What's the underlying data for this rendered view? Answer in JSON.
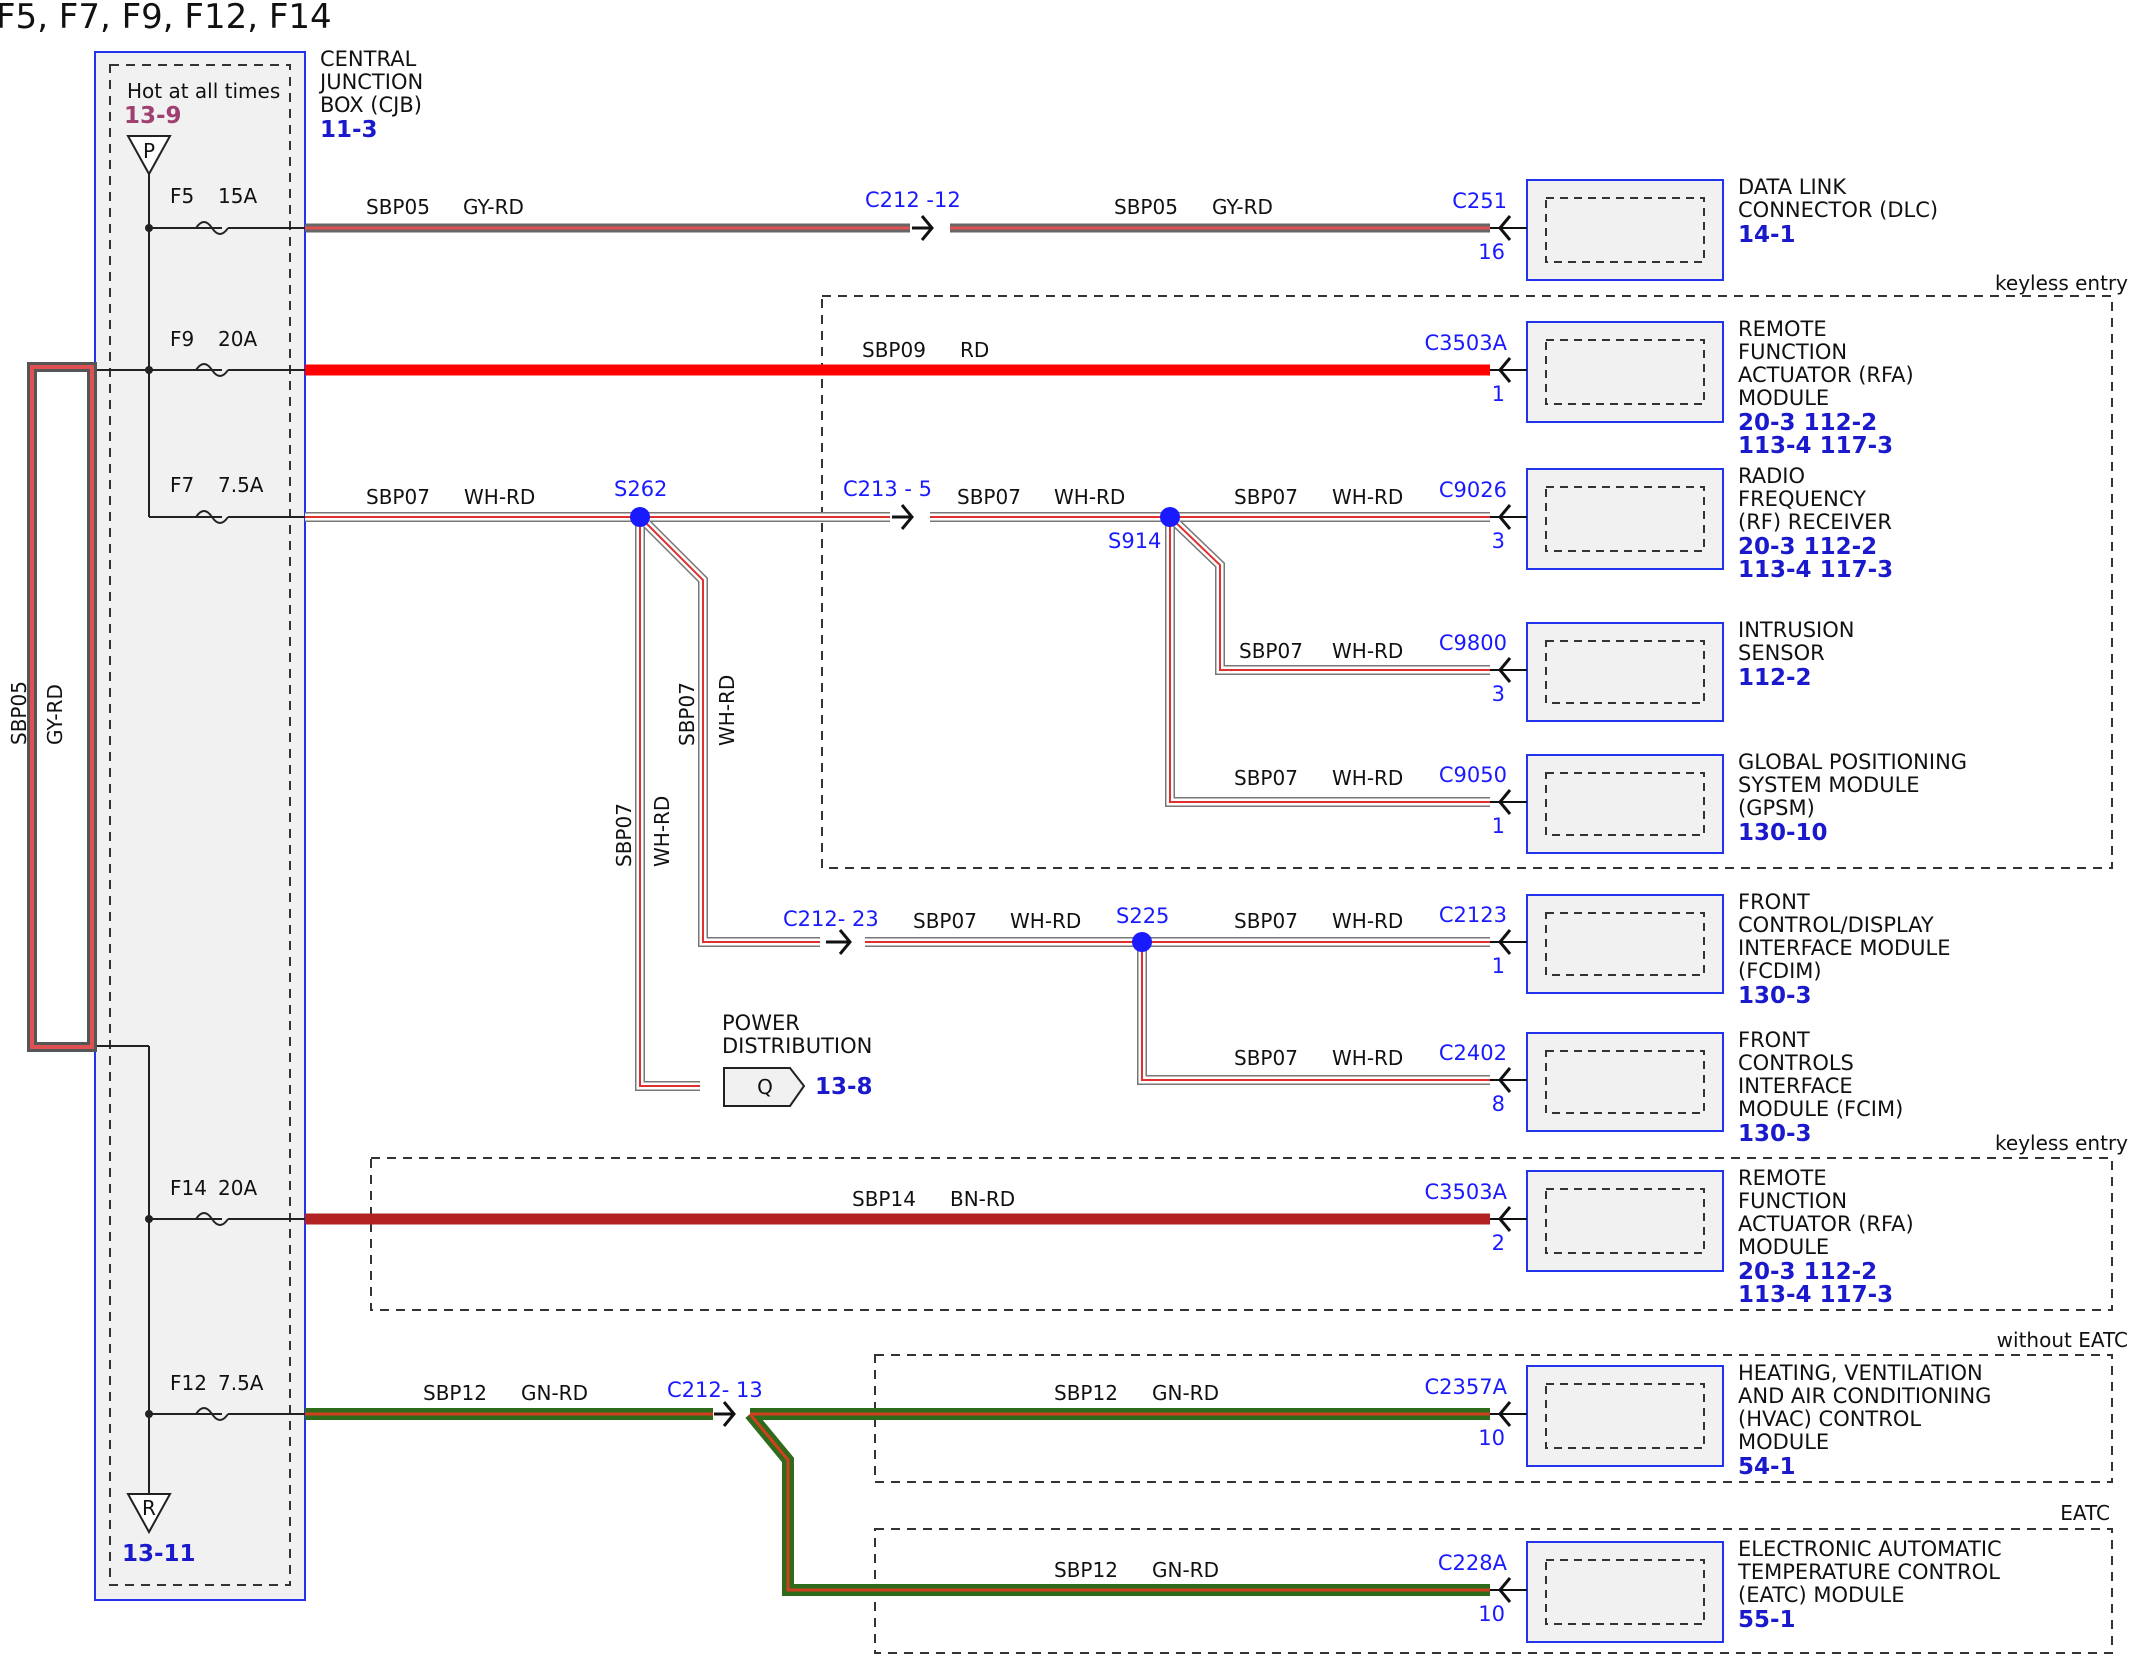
{
  "title": "F5, F7, F9, F12, F14",
  "cjb": {
    "hot_label": "Hot at all times",
    "hot_ref": "13-9",
    "top_symbol": "P",
    "bottom_symbol": "R",
    "bottom_ref": "13-11",
    "name_lines": [
      "CENTRAL",
      "JUNCTION",
      "BOX (CJB)"
    ],
    "name_ref": "11-3"
  },
  "fuses": {
    "f5": "F5",
    "f5_amp": "15A",
    "f9": "F9",
    "f9_amp": "20A",
    "f7": "F7",
    "f7_amp": "7.5A",
    "f14": "F14",
    "f14_amp": "20A",
    "f12": "F12",
    "f12_amp": "7.5A"
  },
  "loop_wire": {
    "circuit": "SBP05",
    "color": "GY-RD"
  },
  "wires": {
    "sbp05_a": {
      "circuit": "SBP05",
      "color": "GY-RD"
    },
    "sbp05_b": {
      "circuit": "SBP05",
      "color": "GY-RD"
    },
    "sbp09": {
      "circuit": "SBP09",
      "color": "RD"
    },
    "sbp07_a": {
      "circuit": "SBP07",
      "color": "WH-RD"
    },
    "sbp07_b": {
      "circuit": "SBP07",
      "color": "WH-RD"
    },
    "sbp07_c": {
      "circuit": "SBP07",
      "color": "WH-RD"
    },
    "sbp07_d": {
      "circuit": "SBP07",
      "color": "WH-RD"
    },
    "sbp07_e": {
      "circuit": "SBP07",
      "color": "WH-RD"
    },
    "sbp07_v1": {
      "circuit": "SBP07",
      "color": "WH-RD"
    },
    "sbp07_v2": {
      "circuit": "SBP07",
      "color": "WH-RD"
    },
    "sbp07_f": {
      "circuit": "SBP07",
      "color": "WH-RD"
    },
    "sbp07_g": {
      "circuit": "SBP07",
      "color": "WH-RD"
    },
    "sbp07_h": {
      "circuit": "SBP07",
      "color": "WH-RD"
    },
    "sbp14": {
      "circuit": "SBP14",
      "color": "BN-RD"
    },
    "sbp12_a": {
      "circuit": "SBP12",
      "color": "GN-RD"
    },
    "sbp12_b": {
      "circuit": "SBP12",
      "color": "GN-RD"
    },
    "sbp12_c": {
      "circuit": "SBP12",
      "color": "GN-RD"
    }
  },
  "inline_connectors": {
    "c212_12": "C212 -12",
    "c213_5": "C213 - 5",
    "c212_23": "C212- 23",
    "c212_13": "C212- 13"
  },
  "splices": {
    "s262": "S262",
    "s914": "S914",
    "s225": "S225"
  },
  "groups": {
    "keyless1": "keyless entry",
    "keyless2": "keyless entry",
    "without_eatc": "without EATC",
    "eatc": "EATC"
  },
  "power_dist": {
    "lines": [
      "POWER",
      "DISTRIBUTION"
    ],
    "symbol": "Q",
    "ref": "13-8"
  },
  "components": [
    {
      "connector": "C251",
      "pin": "16",
      "lines": [
        "DATA LINK",
        "CONNECTOR (DLC)"
      ],
      "refs": [
        "14-1"
      ]
    },
    {
      "connector": "C3503A",
      "pin": "1",
      "lines": [
        "REMOTE",
        "FUNCTION",
        "ACTUATOR (RFA)",
        "MODULE"
      ],
      "refs": [
        "20-3  112-2",
        "113-4 117-3"
      ]
    },
    {
      "connector": "C9026",
      "pin": "3",
      "lines": [
        "RADIO",
        "FREQUENCY",
        "(RF) RECEIVER"
      ],
      "refs": [
        "20-3  112-2",
        "113-4 117-3"
      ]
    },
    {
      "connector": "C9800",
      "pin": "3",
      "lines": [
        "INTRUSION",
        "SENSOR"
      ],
      "refs": [
        "112-2"
      ]
    },
    {
      "connector": "C9050",
      "pin": "1",
      "lines": [
        "GLOBAL POSITIONING",
        "SYSTEM MODULE",
        "(GPSM)"
      ],
      "refs": [
        "130-10"
      ]
    },
    {
      "connector": "C2123",
      "pin": "1",
      "lines": [
        "FRONT",
        "CONTROL/DISPLAY",
        "INTERFACE MODULE",
        "(FCDIM)"
      ],
      "refs": [
        "130-3"
      ]
    },
    {
      "connector": "C2402",
      "pin": "8",
      "lines": [
        "FRONT",
        "CONTROLS",
        "INTERFACE",
        "MODULE (FCIM)"
      ],
      "refs": [
        "130-3"
      ]
    },
    {
      "connector": "C3503A",
      "pin": "2",
      "lines": [
        "REMOTE",
        "FUNCTION",
        "ACTUATOR (RFA)",
        "MODULE"
      ],
      "refs": [
        "20-3  112-2",
        "113-4 117-3"
      ]
    },
    {
      "connector": "C2357A",
      "pin": "10",
      "lines": [
        "HEATING, VENTILATION",
        "AND AIR CONDITIONING",
        "(HVAC) CONTROL",
        "MODULE"
      ],
      "refs": [
        "54-1"
      ]
    },
    {
      "connector": "C228A",
      "pin": "10",
      "lines": [
        "ELECTRONIC AUTOMATIC",
        "TEMPERATURE CONTROL",
        "(EATC) MODULE"
      ],
      "refs": [
        "55-1"
      ]
    }
  ],
  "colors": {
    "gy_rd": "#888888",
    "red": "#ff0000",
    "bn_rd": "#b22222",
    "gn_rd": "#2e6b1a",
    "wh": "#ffffff",
    "splice": "#1a1aff",
    "border_blue": "#2233ee"
  }
}
